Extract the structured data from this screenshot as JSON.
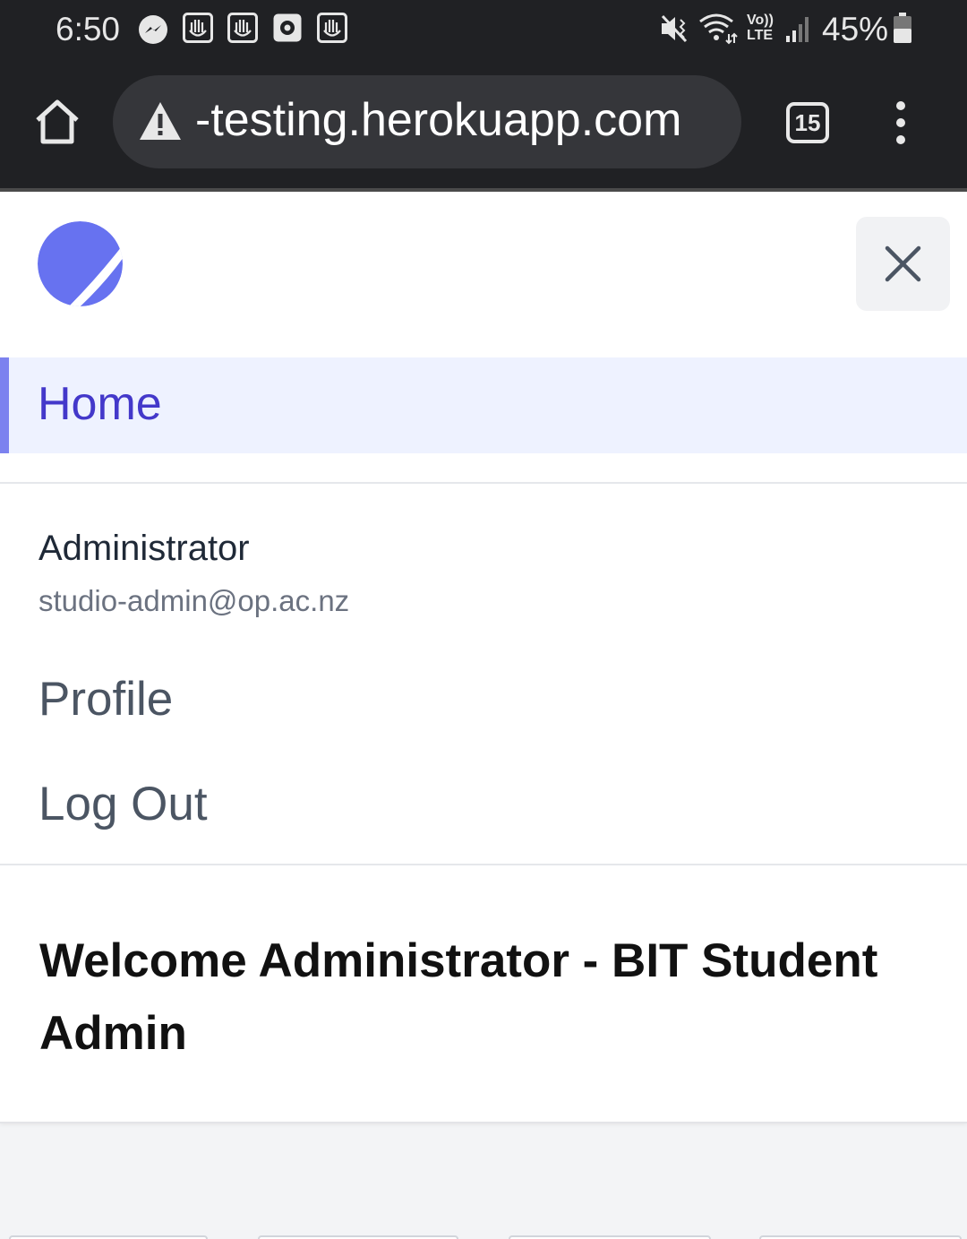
{
  "status_bar": {
    "time": "6:50",
    "left_icons": [
      "messenger-icon",
      "hand-app-icon",
      "hand-app-icon",
      "record-icon",
      "hand-app-icon"
    ],
    "right_icons": [
      "mute-vibrate-icon",
      "wifi-icon",
      "volte-icon",
      "signal-icon",
      "battery-icon"
    ],
    "battery": "45%"
  },
  "browser": {
    "url": "-testing.herokuapp.com",
    "tab_count": "15",
    "security_icon": "warning-triangle-icon"
  },
  "drawer": {
    "logo": "planet-logo",
    "nav_home": "Home",
    "user": {
      "name": "Administrator",
      "email": "studio-admin@op.ac.nz"
    },
    "profile_label": "Profile",
    "logout_label": "Log Out",
    "close_icon": "close-icon"
  },
  "main": {
    "heading": "Welcome Administrator - BIT Student Admin"
  },
  "colors": {
    "accent": "#4338ca",
    "accent_bar": "#7c82ef",
    "logo": "#6772f0",
    "active_bg": "#eef2ff"
  }
}
